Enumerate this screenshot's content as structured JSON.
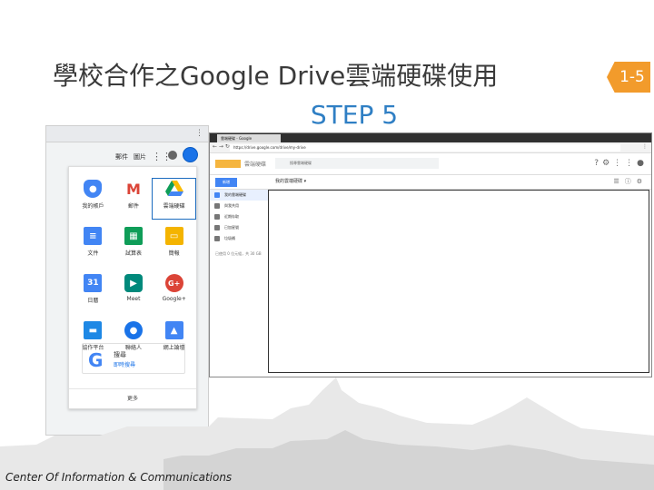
{
  "slide": {
    "title": "學校合作之Google Drive雲端硬碟使用",
    "step": "STEP 5",
    "page": "1-5",
    "footer": "Center Of Information & Communications"
  },
  "apps_menu": {
    "header": {
      "mail": "郵件",
      "images": "圖片"
    },
    "apps": [
      {
        "name": "我的帳戶",
        "icon": "account-icon",
        "glyph": "●"
      },
      {
        "name": "郵件",
        "icon": "gmail-icon",
        "glyph": "M"
      },
      {
        "name": "雲端硬碟",
        "icon": "drive-icon",
        "glyph": "▲",
        "selected": true
      },
      {
        "name": "文件",
        "icon": "docs-icon",
        "glyph": "≡"
      },
      {
        "name": "試算表",
        "icon": "sheets-icon",
        "glyph": "▦"
      },
      {
        "name": "簡報",
        "icon": "slides-icon",
        "glyph": "▭"
      },
      {
        "name": "日曆",
        "icon": "calendar-icon",
        "glyph": "31"
      },
      {
        "name": "Meet",
        "icon": "meet-icon",
        "glyph": "▶"
      },
      {
        "name": "Google+",
        "icon": "google-plus-icon",
        "glyph": "G+"
      },
      {
        "name": "協作平台",
        "icon": "classroom-icon",
        "glyph": "▬"
      },
      {
        "name": "聯絡人",
        "icon": "contacts-icon",
        "glyph": "●"
      },
      {
        "name": "網上論壇",
        "icon": "groups-icon",
        "glyph": "▲"
      }
    ],
    "search_card": {
      "letter": "G",
      "title": "搜尋",
      "subtitle": "即時搜尋"
    },
    "more": "更多"
  },
  "drive": {
    "tab": "雲端硬碟 - Google",
    "url": "https://drive.google.com/drive/my-drive",
    "brand": "雲端硬碟",
    "search_placeholder": "搜尋雲端硬碟",
    "new_button": "新增",
    "my_drive": "我的雲端硬碟 ▾",
    "sidebar": [
      "我的雲端硬碟",
      "與我共用",
      "近期存取",
      "已加星號",
      "垃圾桶"
    ],
    "storage": "已使用 0 位元組，共 30 GB"
  }
}
